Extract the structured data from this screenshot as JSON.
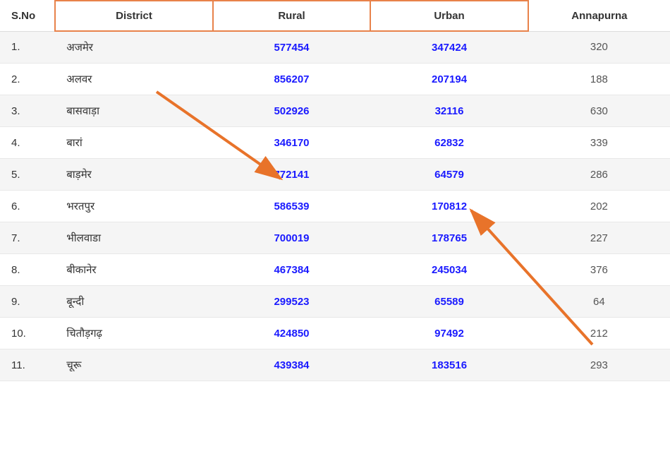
{
  "header": {
    "sno_label": "S.No",
    "district_label": "District",
    "rural_label": "Rural",
    "urban_label": "Urban",
    "annapurna_label": "Annapurna"
  },
  "rows": [
    {
      "sno": "1.",
      "district": "अजमेर",
      "rural": "577454",
      "urban": "347424",
      "annapurna": "320"
    },
    {
      "sno": "2.",
      "district": "अलवर",
      "rural": "856207",
      "urban": "207194",
      "annapurna": "188"
    },
    {
      "sno": "3.",
      "district": "बासवाड़ा",
      "rural": "502926",
      "urban": "32116",
      "annapurna": "630"
    },
    {
      "sno": "4.",
      "district": "बारां",
      "rural": "346170",
      "urban": "62832",
      "annapurna": "339"
    },
    {
      "sno": "5.",
      "district": "बाड़मेर",
      "rural": "772141",
      "urban": "64579",
      "annapurna": "286"
    },
    {
      "sno": "6.",
      "district": "भरतपुर",
      "rural": "586539",
      "urban": "170812",
      "annapurna": "202"
    },
    {
      "sno": "7.",
      "district": "भीलवाडा",
      "rural": "700019",
      "urban": "178765",
      "annapurna": "227"
    },
    {
      "sno": "8.",
      "district": "बीकानेर",
      "rural": "467384",
      "urban": "245034",
      "annapurna": "376"
    },
    {
      "sno": "9.",
      "district": "बून्दी",
      "rural": "299523",
      "urban": "65589",
      "annapurna": "64"
    },
    {
      "sno": "10.",
      "district": "चितौड़गढ़",
      "rural": "424850",
      "urban": "97492",
      "annapurna": "212"
    },
    {
      "sno": "11.",
      "district": "चूरू",
      "rural": "439384",
      "urban": "183516",
      "annapurna": "293"
    }
  ]
}
